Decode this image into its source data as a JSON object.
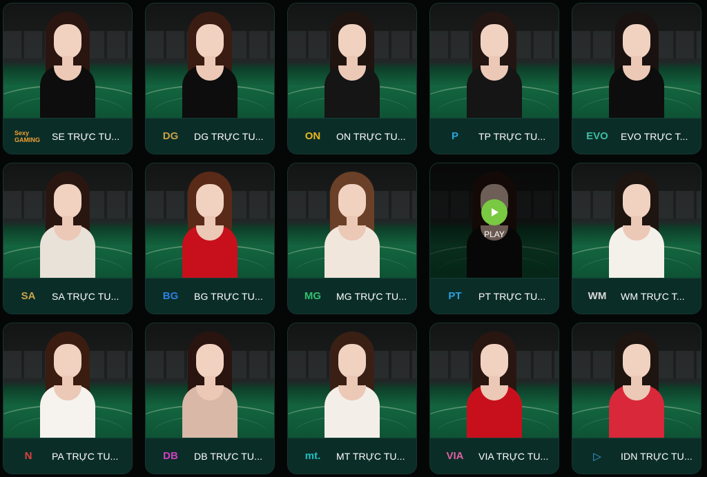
{
  "games": [
    {
      "label": "SE TRỰC TU...",
      "logo": "Sexy GAMING",
      "logo_icon": "sexy-gaming-logo",
      "logo_color": "#f0a030",
      "hair": "#2a1510",
      "dress": "#0d0d0d"
    },
    {
      "label": "DG TRỰC TU...",
      "logo": "DG",
      "logo_icon": "dream-gaming-logo",
      "logo_color": "#c8a04a",
      "hair": "#3a1c12",
      "dress": "#0d0d0d"
    },
    {
      "label": "ON TRỰC TU...",
      "logo": "ON",
      "logo_icon": "on-casino-logo",
      "logo_color": "#e8b820",
      "hair": "#1f1410",
      "dress": "#151515"
    },
    {
      "label": "TP TRỰC TU...",
      "logo": "P",
      "logo_icon": "tp-gaming-logo",
      "logo_color": "#2aa8e0",
      "hair": "#221512",
      "dress": "#151515"
    },
    {
      "label": "EVO TRỰC T...",
      "logo": "EVO",
      "logo_icon": "evolution-logo",
      "logo_color": "#3bbfa0",
      "hair": "#1a1210",
      "dress": "#0d0d0d"
    },
    {
      "label": "SA TRỰC TU...",
      "logo": "SA",
      "logo_icon": "sa-gaming-logo",
      "logo_color": "#c9a64a",
      "hair": "#2a1610",
      "dress": "#e9e2d8"
    },
    {
      "label": "BG TRỰC TU...",
      "logo": "BG",
      "logo_icon": "big-gaming-logo",
      "logo_color": "#2f7fe0",
      "hair": "#5a2a18",
      "dress": "#c8101c"
    },
    {
      "label": "MG TRỰC TU...",
      "logo": "MG",
      "logo_icon": "microgaming-logo",
      "logo_color": "#33c070",
      "hair": "#6a4028",
      "dress": "#f1e6dc"
    },
    {
      "label": "PT TRỰC TU...",
      "logo": "PT",
      "logo_icon": "playtech-logo",
      "logo_color": "#2aa0e0",
      "hair": "#2a1610",
      "dress": "#111111",
      "play": "PLAY"
    },
    {
      "label": "WM TRỰC T...",
      "logo": "WM",
      "logo_icon": "wm-casino-logo",
      "logo_color": "#d8d8d8",
      "hair": "#1e1410",
      "dress": "#f4f0ea"
    },
    {
      "label": "PA TRỰC TU...",
      "logo": "N",
      "logo_icon": "pa-casino-logo",
      "logo_color": "#e04040",
      "hair": "#3a1c10",
      "dress": "#f6f2ee"
    },
    {
      "label": "DB TRỰC TU...",
      "logo": "DB",
      "logo_icon": "db-casino-logo",
      "logo_color": "#d040c0",
      "hair": "#2a1410",
      "dress": "#d9b8a8"
    },
    {
      "label": "MT TRỰC TU...",
      "logo": "mt.",
      "logo_icon": "mt-casino-logo",
      "logo_color": "#20c0c0",
      "hair": "#3a2014",
      "dress": "#f4eee8"
    },
    {
      "label": "VIA TRỰC TU...",
      "logo": "VIA",
      "logo_icon": "via-casino-logo",
      "logo_color": "#e060a0",
      "hair": "#2a1610",
      "dress": "#c8101c"
    },
    {
      "label": "IDN TRỰC TU...",
      "logo": "▷",
      "logo_icon": "idn-live-logo",
      "logo_color": "#40a0e0",
      "hair": "#1e1410",
      "dress": "#d8283a"
    }
  ]
}
